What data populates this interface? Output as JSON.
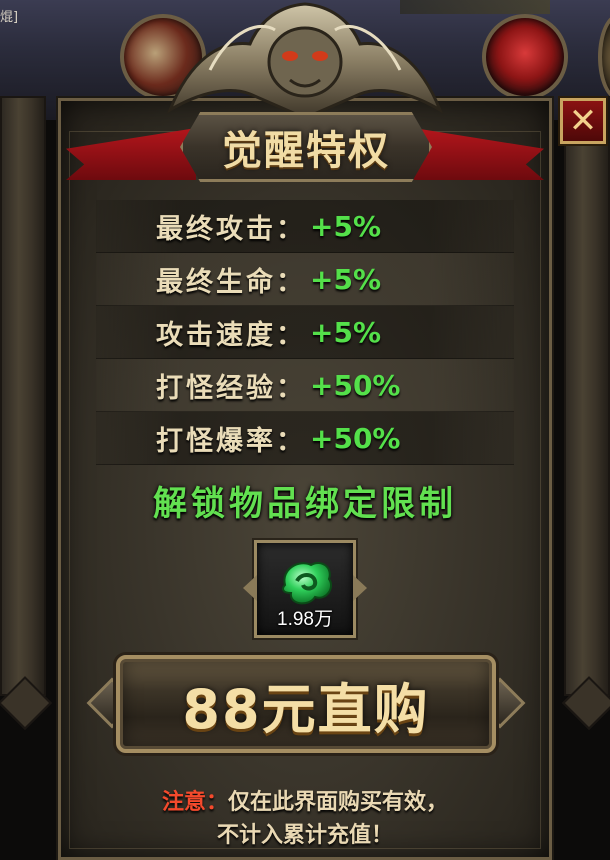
{
  "background": {
    "top_left_label": "焜]"
  },
  "title": "觉醒特权",
  "close_label": "✕",
  "stats": [
    {
      "label": "最终攻击：",
      "value": "+5%"
    },
    {
      "label": "最终生命：",
      "value": "+5%"
    },
    {
      "label": "攻击速度：",
      "value": "+5%"
    },
    {
      "label": "打怪经验：",
      "value": "+50%"
    },
    {
      "label": "打怪爆率：",
      "value": "+50%"
    }
  ],
  "unlock_text": "解锁物品绑定限制",
  "item": {
    "icon": "jade-pendant-icon",
    "count": "1.98万"
  },
  "buy_button": {
    "label": "88元直购"
  },
  "notice": {
    "prefix": "注意：",
    "line1": "仅在此界面购买有效，",
    "line2": "不计入累计充值！"
  },
  "colors": {
    "stat_value": "#54e04a",
    "unlock_text": "#62e050",
    "notice_prefix": "#f44a2c",
    "title": "#f1dca5",
    "ribbon": "#b3161c",
    "close_bg": "#8a1212"
  }
}
